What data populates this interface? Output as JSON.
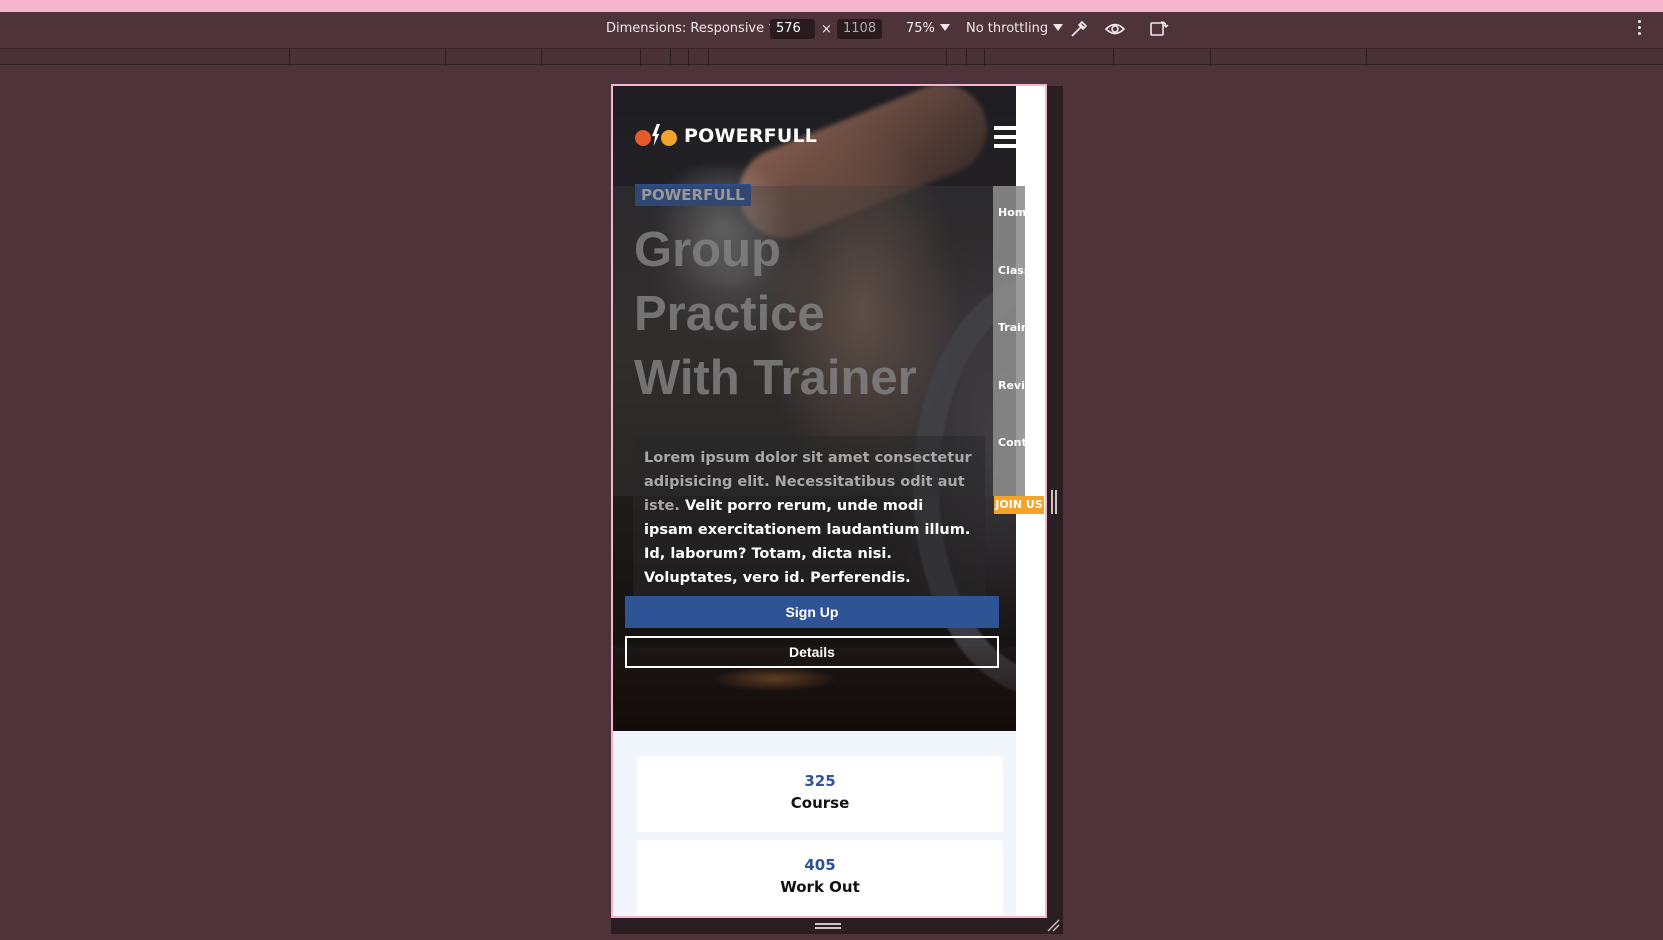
{
  "devtools": {
    "dimensions_label": "Dimensions: Responsive",
    "width": "576",
    "height": "1108",
    "zoom": "75%",
    "throttling": "No throttling",
    "icons": [
      "eyedropper-icon",
      "eye-icon",
      "rotate-icon",
      "kebab-menu-icon"
    ]
  },
  "site": {
    "brand": "POWERFULL",
    "tag": "POWERFULL",
    "hero_title": [
      "Group",
      "Practice",
      "With Trainer"
    ],
    "description_dim": "Lorem ipsum dolor sit amet consectetur adipisicing elit. Necessitatibus odit aut iste.",
    "description": "Velit porro rerum, unde modi ipsam exercitationem laudantium illum. Id, laborum? Totam, dicta nisi. Voluptates, vero id. Perferendis.",
    "nav": [
      "Home",
      "Classes",
      "Trainer",
      "Review",
      "Contact"
    ],
    "join_label": "JOIN US",
    "signup_label": "Sign Up",
    "details_label": "Details",
    "stats": [
      {
        "value": "325",
        "label": "Course"
      },
      {
        "value": "405",
        "label": "Work Out"
      }
    ],
    "colors": {
      "accent": "#2f5495",
      "join": "#f3a32a",
      "frame": "#f3b6cc"
    }
  }
}
